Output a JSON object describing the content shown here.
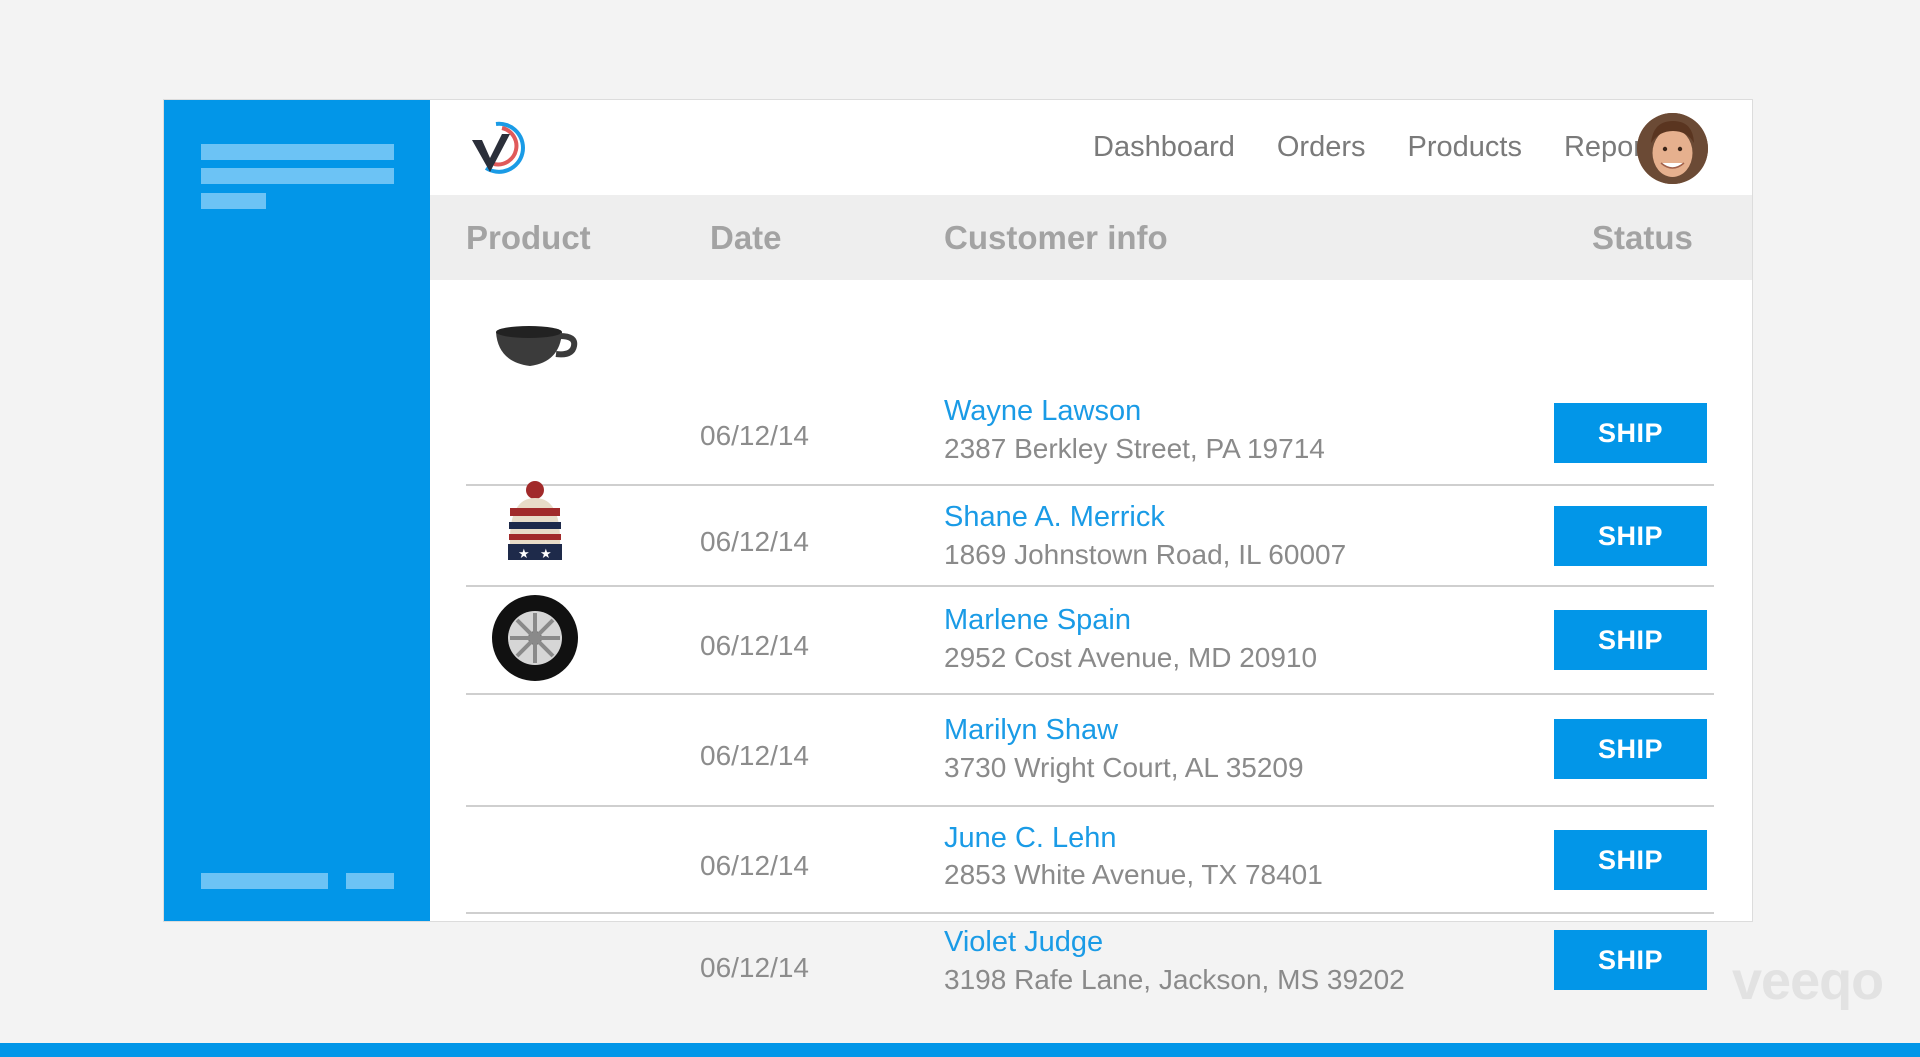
{
  "nav": {
    "items": [
      "Dashboard",
      "Orders",
      "Products",
      "Reports"
    ]
  },
  "table": {
    "headers": {
      "product": "Product",
      "date": "Date",
      "customer": "Customer info",
      "status": "Status"
    },
    "rows": [
      {
        "product_icon": "mug-icon",
        "date": "06/12/14",
        "name": "Wayne Lawson",
        "address": "2387 Berkley Street, PA 19714",
        "action": "SHIP"
      },
      {
        "product_icon": "beanie-hat-icon",
        "date": "06/12/14",
        "name": "Shane A. Merrick",
        "address": "1869 Johnstown Road, IL 60007",
        "action": "SHIP"
      },
      {
        "product_icon": "tire-icon",
        "date": "06/12/14",
        "name": "Marlene Spain",
        "address": "2952 Cost Avenue, MD 20910",
        "action": "SHIP"
      },
      {
        "product_icon": "",
        "date": "06/12/14",
        "name": "Marilyn Shaw",
        "address": "3730 Wright Court, AL 35209",
        "action": "SHIP"
      },
      {
        "product_icon": "",
        "date": "06/12/14",
        "name": "June C. Lehn",
        "address": "2853 White Avenue, TX 78401",
        "action": "SHIP"
      },
      {
        "product_icon": "",
        "date": "06/12/14",
        "name": "Violet Judge",
        "address": "3198 Rafe Lane, Jackson, MS 39202",
        "action": "SHIP"
      }
    ]
  },
  "watermark": "veeqo",
  "colors": {
    "brand_blue": "#0296e8",
    "link_blue": "#1a9be6",
    "sidebar_placeholder": "#6cc3f5",
    "header_bg": "#eeeeee"
  }
}
